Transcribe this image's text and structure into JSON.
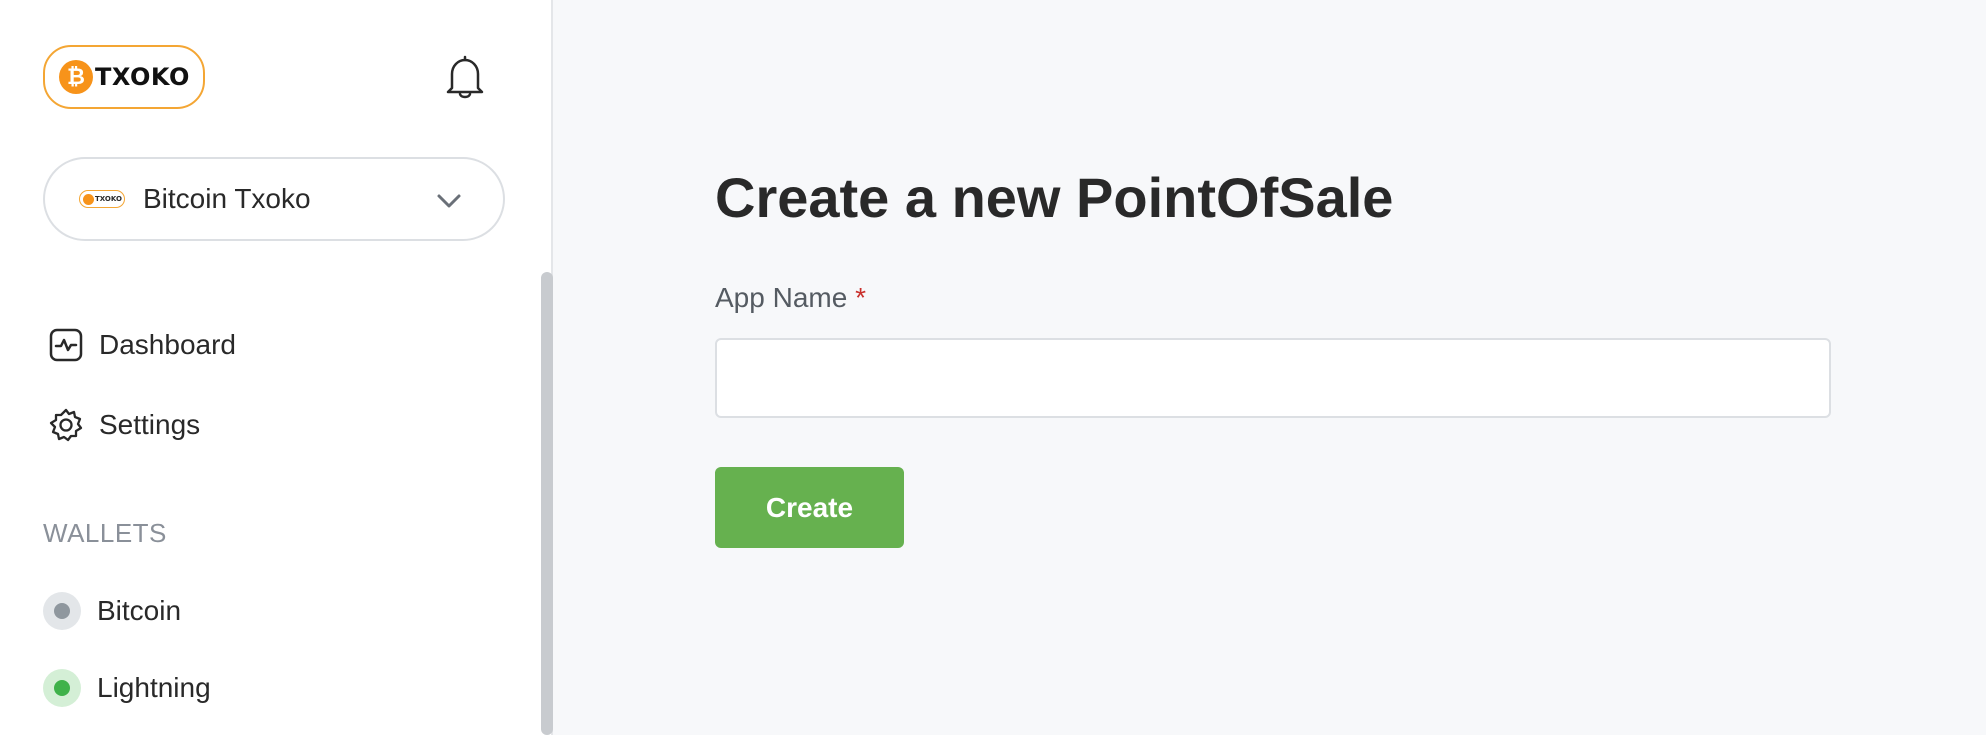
{
  "brand": {
    "logo_text": "TXOKO",
    "logo_coin_glyph": "₿",
    "mini_logo_text": "TXOKO",
    "accent_color": "#f4a634"
  },
  "header": {
    "notification_icon": "bell-icon"
  },
  "store_selector": {
    "selected": "Bitcoin Txoko",
    "icon": "chevron-down-icon"
  },
  "nav": {
    "items": [
      {
        "label": "Dashboard",
        "icon": "dashboard-icon"
      },
      {
        "label": "Settings",
        "icon": "gear-icon"
      }
    ]
  },
  "wallets": {
    "title": "WALLETS",
    "items": [
      {
        "label": "Bitcoin",
        "status_color": "#8f979e"
      },
      {
        "label": "Lightning",
        "status_color": "#3fb24a"
      }
    ]
  },
  "main": {
    "title": "Create a new PointOfSale",
    "form": {
      "app_name_label": "App Name",
      "required_marker": "*",
      "app_name_value": "",
      "app_name_placeholder": "",
      "submit_label": "Create",
      "submit_color": "#66b14f"
    }
  }
}
